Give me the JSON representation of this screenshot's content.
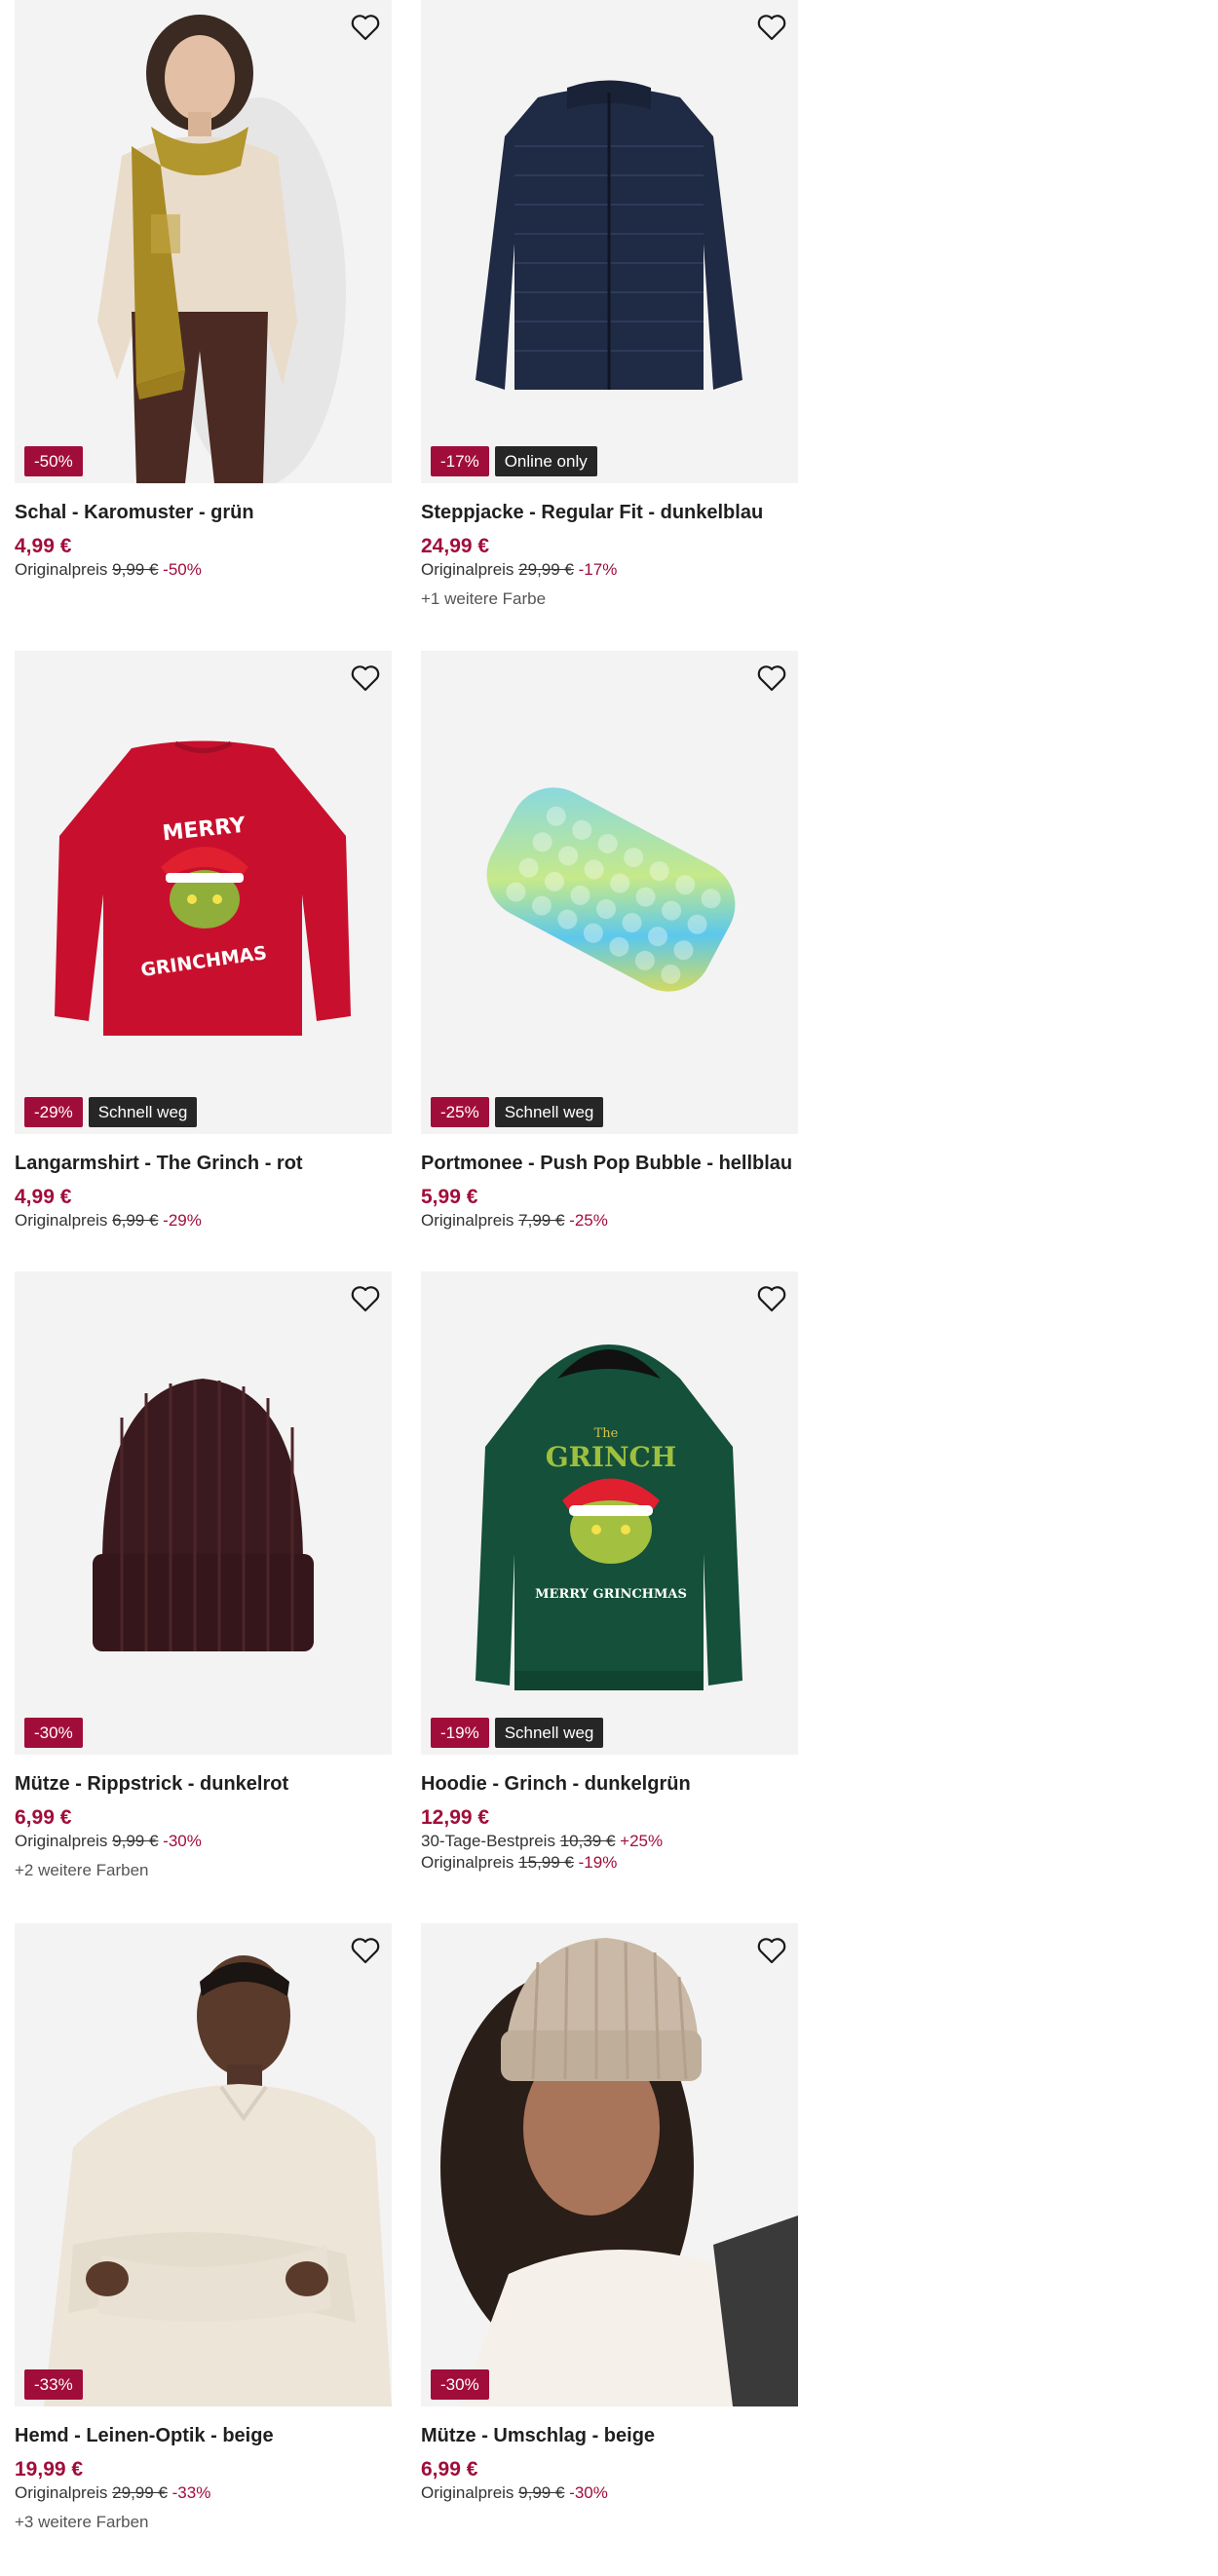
{
  "icons": {
    "favorite": "heart-outline-icon"
  },
  "colors": {
    "sale": "#a10d3b",
    "badge_dark": "#262626",
    "tile_bg": "#f2f2f2"
  },
  "products": [
    {
      "title": "Schal - Karomuster - grün",
      "price": "4,99 €",
      "badges": {
        "discount": "-50%"
      },
      "orig_label": "Originalpreis",
      "orig_price": "9,99 €",
      "orig_pct": "-50%"
    },
    {
      "title": "Steppjacke - Regular Fit - dunkelblau",
      "price": "24,99 €",
      "badges": {
        "discount": "-17%",
        "extra": "Online only"
      },
      "orig_label": "Originalpreis",
      "orig_price": "29,99 €",
      "orig_pct": "-17%",
      "more_colors": "+1 weitere Farbe"
    },
    {
      "title": "Langarmshirt - The Grinch - rot",
      "price": "4,99 €",
      "badges": {
        "discount": "-29%",
        "extra": "Schnell weg"
      },
      "orig_label": "Originalpreis",
      "orig_price": "6,99 €",
      "orig_pct": "-29%",
      "print": {
        "line1": "MERRY",
        "line2": "GRINCHMAS"
      }
    },
    {
      "title": "Portmonee - Push Pop Bubble - hellblau",
      "price": "5,99 €",
      "badges": {
        "discount": "-25%",
        "extra": "Schnell weg"
      },
      "orig_label": "Originalpreis",
      "orig_price": "7,99 €",
      "orig_pct": "-25%"
    },
    {
      "title": "Mütze - Rippstrick - dunkelrot",
      "price": "6,99 €",
      "badges": {
        "discount": "-30%"
      },
      "orig_label": "Originalpreis",
      "orig_price": "9,99 €",
      "orig_pct": "-30%",
      "more_colors": "+2 weitere Farben"
    },
    {
      "title": "Hoodie - Grinch - dunkelgrün",
      "price": "12,99 €",
      "badges": {
        "discount": "-19%",
        "extra": "Schnell weg"
      },
      "best_label": "30-Tage-Bestpreis",
      "best_price": "10,39 €",
      "best_pct": "+25%",
      "orig_label": "Originalpreis",
      "orig_price": "15,99 €",
      "orig_pct": "-19%",
      "print": {
        "line1": "The",
        "line2": "GRINCH",
        "line3": "MERRY GRINCHMAS"
      }
    },
    {
      "title": "Hemd - Leinen-Optik - beige",
      "price": "19,99 €",
      "badges": {
        "discount": "-33%"
      },
      "orig_label": "Originalpreis",
      "orig_price": "29,99 €",
      "orig_pct": "-33%",
      "more_colors": "+3 weitere Farben"
    },
    {
      "title": "Mütze - Umschlag - beige",
      "price": "6,99 €",
      "badges": {
        "discount": "-30%"
      },
      "orig_label": "Originalpreis",
      "orig_price": "9,99 €",
      "orig_pct": "-30%"
    }
  ]
}
